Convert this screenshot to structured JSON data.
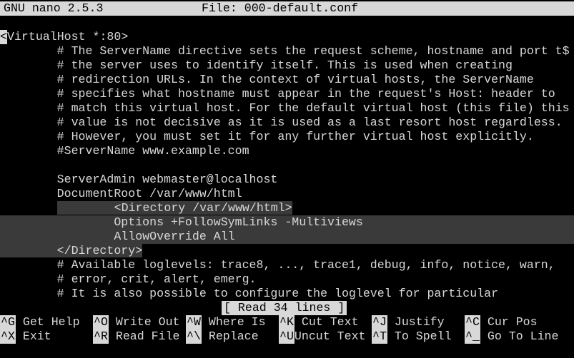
{
  "title_bar": {
    "version": "GNU nano 2.5.3",
    "file": "File: 000-default.conf"
  },
  "lines": [
    "",
    "VirtualHost *:80>",
    "        # The ServerName directive sets the request scheme, hostname and port t$",
    "        # the server uses to identify itself. This is used when creating",
    "        # redirection URLs. In the context of virtual hosts, the ServerName",
    "        # specifies what hostname must appear in the request's Host: header to",
    "        # match this virtual host. For the default virtual host (this file) this",
    "        # value is not decisive as it is used as a last resort host regardless.",
    "        # However, you must set it for any further virtual host explicitly.",
    "        #ServerName www.example.com",
    "",
    "        ServerAdmin webmaster@localhost",
    "        DocumentRoot /var/www/html",
    "        <Directory /var/www/html>",
    "                Options +FollowSymLinks -Multiviews",
    "                AllowOverride All",
    "        </Directory>",
    "        # Available loglevels: trace8, ..., trace1, debug, info, notice, warn,",
    "        # error, crit, alert, emerg.",
    "        # It is also possible to configure the loglevel for particular"
  ],
  "cursor_char": "<",
  "status_message": "[ Read 34 lines ]",
  "shortcuts": [
    {
      "key": "^G",
      "label": "Get Help"
    },
    {
      "key": "^O",
      "label": "Write Out"
    },
    {
      "key": "^W",
      "label": "Where Is"
    },
    {
      "key": "^K",
      "label": "Cut Text"
    },
    {
      "key": "^J",
      "label": "Justify"
    },
    {
      "key": "^C",
      "label": "Cur Pos"
    },
    {
      "key": "^X",
      "label": "Exit"
    },
    {
      "key": "^R",
      "label": "Read File"
    },
    {
      "key": "^\\",
      "label": "Replace"
    },
    {
      "key": "^U",
      "label": "Uncut Text"
    },
    {
      "key": "^T",
      "label": "To Spell"
    },
    {
      "key": "^_",
      "label": "Go To Line"
    }
  ]
}
